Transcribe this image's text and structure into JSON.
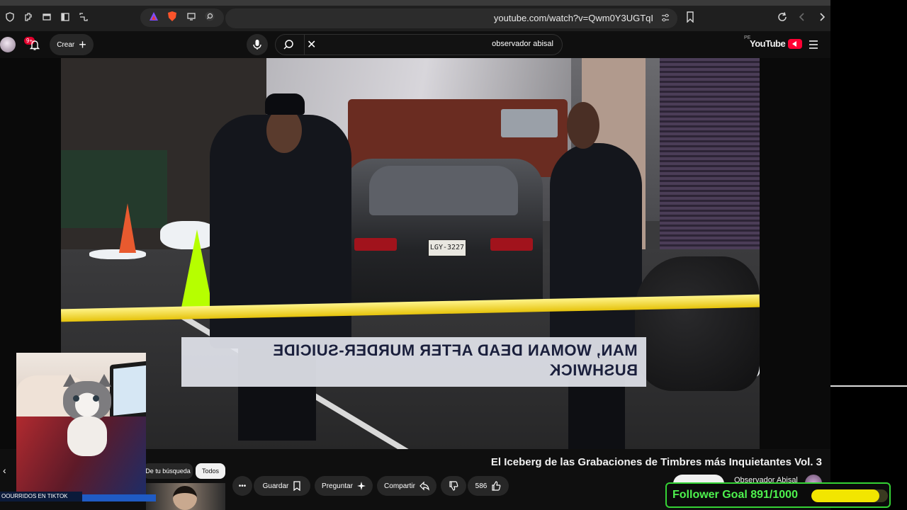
{
  "browser": {
    "url": "youtube.com/watch?v=Qwm0Y3UGTqI"
  },
  "header": {
    "logo": "YouTube",
    "region": "PE",
    "search_query": "observador abisal",
    "create_label": "Crear",
    "notification_count": "9+"
  },
  "video": {
    "headline_line1": "MAN, WOMAN DEAD AFTER MURDER-SUICIDE",
    "headline_line2": "BUSHWICK",
    "plate": "LGY-3227"
  },
  "below": {
    "title": "El Iceberg de las Grabaciones de Timbres más Inquietantes Vol. 3",
    "channel_name": "Observador Abisal",
    "like_count": "586",
    "share_label": "Compartir",
    "ask_label": "Preguntar",
    "save_label": "Guardar",
    "chips": [
      "Todos",
      "De tu búsqueda"
    ]
  },
  "overlays": {
    "webcam_label": "OOURRIDOS EN TIKTOK",
    "goal_label": "Follower Goal 891/1000",
    "goal_progress": 0.891,
    "goal_color": "#4ef24e",
    "goal_bar_color": "#f2e600"
  }
}
